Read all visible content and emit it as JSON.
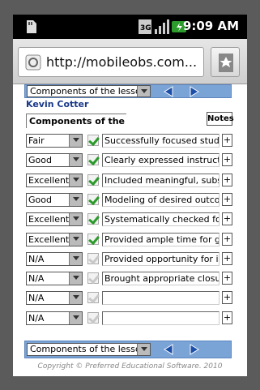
{
  "status": {
    "time": "9:09 AM"
  },
  "browser": {
    "url": "http://mobileobs.com..."
  },
  "top_nav": {
    "select_value": "Components of the lesson"
  },
  "teacher": {
    "name": "Kevin Cotter"
  },
  "section": {
    "field_value": "Components of the less",
    "notes_label": "Notes"
  },
  "rows": [
    {
      "rating": "Fair",
      "checked": true,
      "description": "Successfully focused student"
    },
    {
      "rating": "Good",
      "checked": true,
      "description": "Clearly expressed instruction"
    },
    {
      "rating": "Excellent",
      "checked": true,
      "description": "Included meaningful, substar"
    },
    {
      "rating": "Good",
      "checked": true,
      "description": "Modeling of desired outcome"
    },
    {
      "rating": "Excellent",
      "checked": true,
      "description": "Systematically checked for sti"
    },
    {
      "rating": "Excellent",
      "checked": true,
      "description": "Provided ample time for guid"
    },
    {
      "rating": "N/A",
      "checked": false,
      "description": "Provided opportunity for inde"
    },
    {
      "rating": "N/A",
      "checked": false,
      "description": "Brought appropriate closure"
    },
    {
      "rating": "N/A",
      "checked": false,
      "description": ""
    },
    {
      "rating": "N/A",
      "checked": false,
      "description": ""
    }
  ],
  "plus_label": "+",
  "bottom_nav": {
    "select_value": "Components of the lesson"
  },
  "footer": {
    "copyright": "Copyright © Preferred Educational Software. 2010"
  },
  "colors": {
    "nav_bar": "#7aa3d6",
    "teacher_name": "#1a3a8a",
    "check_on": "#2a9a2a"
  }
}
